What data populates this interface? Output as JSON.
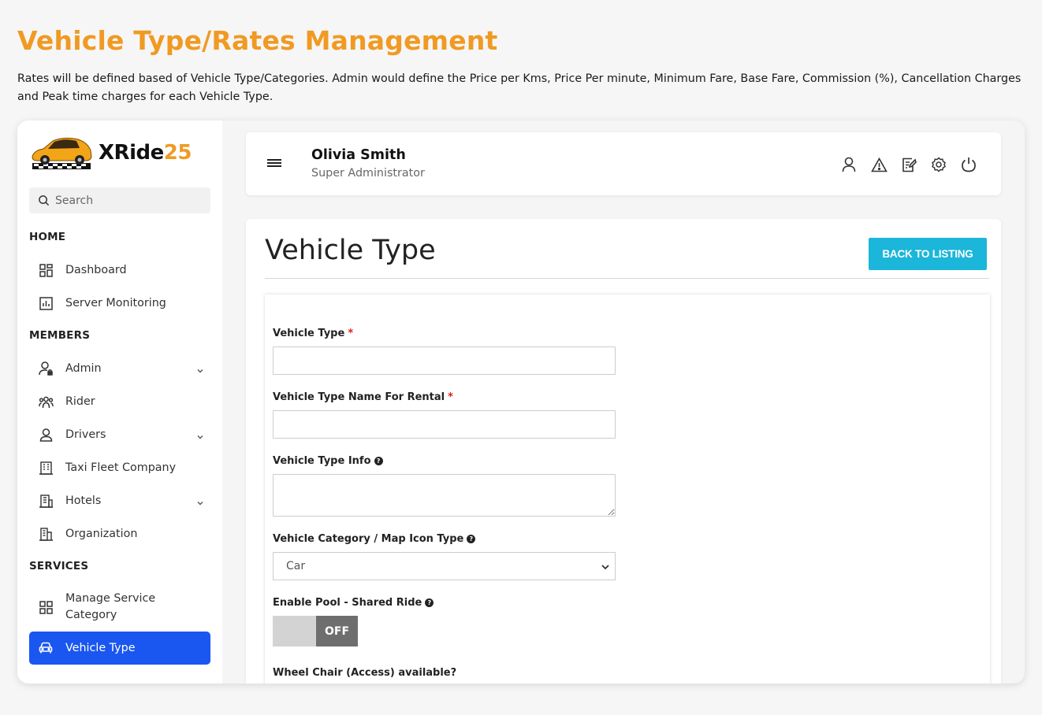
{
  "page": {
    "heading": "Vehicle Type/Rates Management",
    "description": "Rates will be defined based of Vehicle Type/Categories. Admin would define the Price per Kms, Price Per minute, Minimum Fare, Base Fare, Commission (%), Cancellation Charges and Peak time charges for each Vehicle Type."
  },
  "logo": {
    "name": "XRide",
    "number": "25"
  },
  "search": {
    "placeholder": "Search"
  },
  "sidebar": {
    "sections": {
      "home": "HOME",
      "members": "MEMBERS",
      "services": "SERVICES"
    },
    "items": {
      "dashboard": "Dashboard",
      "server_monitoring": "Server Monitoring",
      "admin": "Admin",
      "rider": "Rider",
      "drivers": "Drivers",
      "taxi_fleet": "Taxi Fleet Company",
      "hotels": "Hotels",
      "organization": "Organization",
      "manage_service_category": "Manage Service Category",
      "vehicle_type": "Vehicle Type"
    }
  },
  "header": {
    "user_name": "Olivia Smith",
    "user_role": "Super Administrator",
    "icons": [
      "user-icon",
      "warning-icon",
      "edit-icon",
      "gear-icon",
      "power-icon"
    ]
  },
  "main": {
    "title": "Vehicle Type",
    "back_button": "BACK TO LISTING"
  },
  "form": {
    "vehicle_type_label": "Vehicle Type",
    "vehicle_type_value": "",
    "rental_name_label": "Vehicle Type Name For Rental",
    "rental_name_value": "",
    "info_label": "Vehicle Type Info",
    "info_value": "",
    "category_label": "Vehicle Category / Map Icon Type",
    "category_value": "Car",
    "pool_label": "Enable Pool - Shared Ride",
    "pool_state": "OFF",
    "wheelchair_label": "Wheel Chair (Access) available?",
    "required_mark": "*"
  },
  "colors": {
    "accent_orange": "#f09a23",
    "active_blue": "#1a56f0",
    "button_cyan": "#1bb6d9",
    "required_red": "#e01b1b"
  }
}
